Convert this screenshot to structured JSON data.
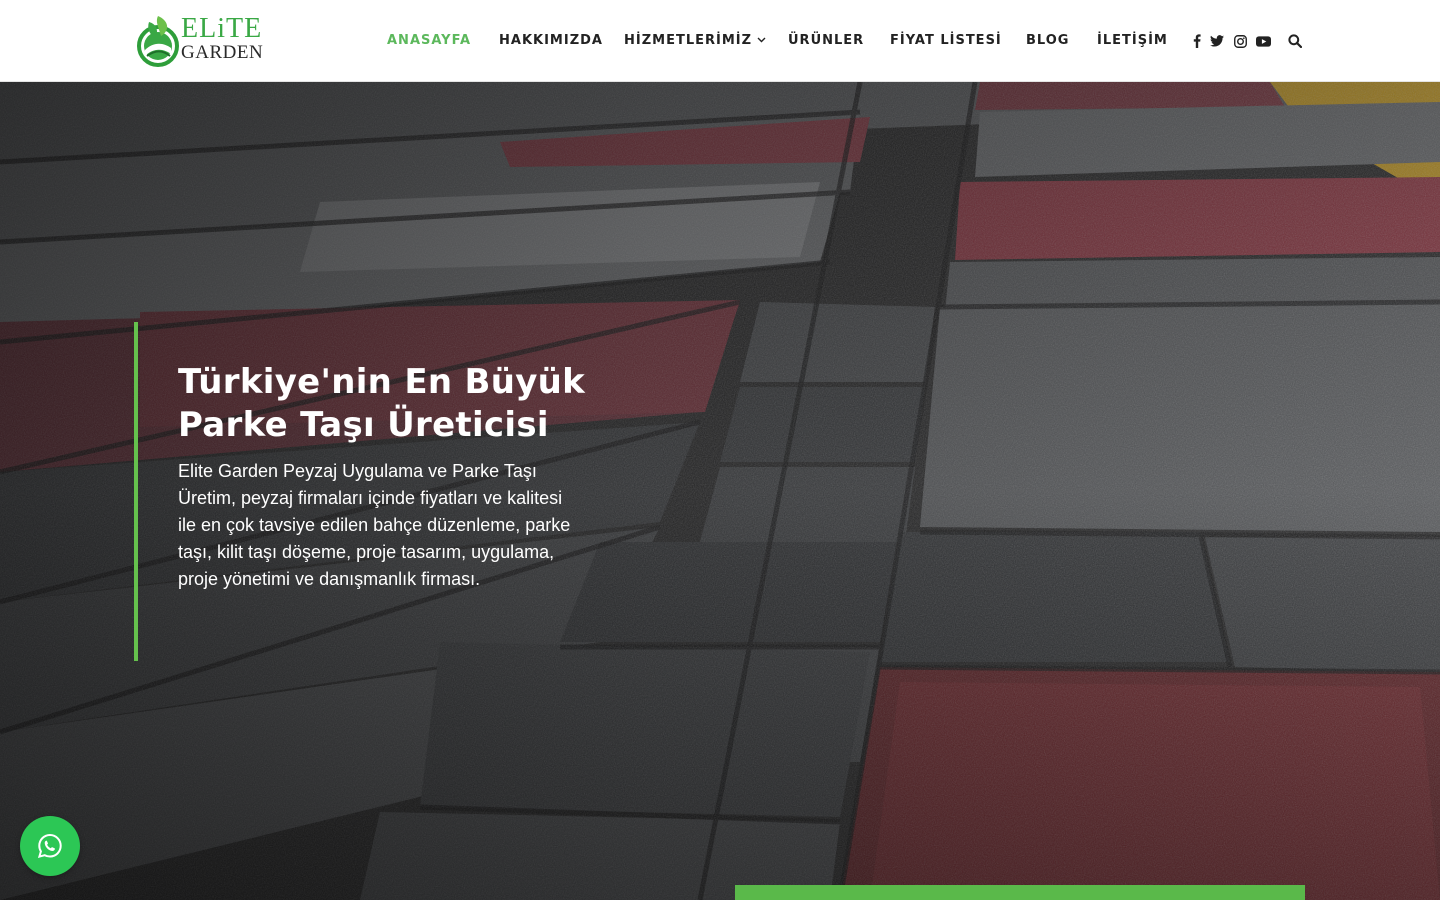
{
  "brand": {
    "name_line1": "ELiTE",
    "name_line2": "GARDEN",
    "logo_icon": "leaf-globe-icon",
    "accent_color": "#5cb85c"
  },
  "nav": {
    "items": [
      {
        "label": "ANASAYFA",
        "active": true
      },
      {
        "label": "HAKKIMIZDA",
        "active": false
      },
      {
        "label": "HİZMETLERİMİZ",
        "active": false,
        "has_dropdown": true
      },
      {
        "label": "ÜRÜNLER",
        "active": false
      },
      {
        "label": "FİYAT LİSTESİ",
        "active": false
      },
      {
        "label": "BLOG",
        "active": false
      },
      {
        "label": "İLETİŞİM",
        "active": false
      }
    ],
    "dropdown_icon": "chevron-down-icon"
  },
  "social": {
    "icons": [
      "facebook-icon",
      "twitter-icon",
      "instagram-icon",
      "youtube-icon"
    ],
    "search_icon": "search-icon"
  },
  "hero": {
    "title": "Türkiye'nin En Büyük Parke Taşı Üreticisi",
    "description": "Elite Garden Peyzaj Uygulama ve Parke Taşı Üretim, peyzaj firmaları içinde fiyatları ve kalitesi ile en çok tavsiye edilen bahçe düzenleme, parke taşı, kilit taşı döşeme, proje tasarım, uygulama, proje yönetimi ve danışmanlık firması.",
    "bar_color": "#65c14d",
    "background": "paving-stones-photo"
  },
  "whatsapp": {
    "icon": "whatsapp-icon",
    "color": "#2cc755"
  }
}
